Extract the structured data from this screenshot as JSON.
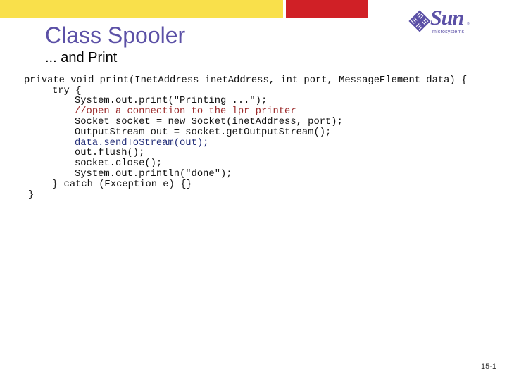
{
  "header": {
    "colors": {
      "yellow": "#f9e04b",
      "red": "#d02026",
      "title": "#5b50a6"
    }
  },
  "slide": {
    "title": "Class Spooler",
    "subtitle": "... and Print",
    "page_number": "15-1"
  },
  "logo": {
    "icon": "sun-diamond-logo-icon",
    "wordmark": "Sun",
    "tm": "®",
    "tagline": "microsystems"
  },
  "code": {
    "lines": [
      {
        "text": "private void print(InetAddress inetAddress, int port, MessageElement data) {",
        "style": "normal"
      },
      {
        "text": "try {",
        "style": "normal"
      },
      {
        "text": "System.out.print(\"Printing ...\");",
        "style": "normal"
      },
      {
        "text": "//open a connection to the lpr printer",
        "style": "comment"
      },
      {
        "text": "Socket socket = new Socket(inetAddress, port);",
        "style": "normal"
      },
      {
        "text": "OutputStream out = socket.getOutputStream();",
        "style": "normal"
      },
      {
        "text": "data.sendToStream(out);",
        "style": "highlight"
      },
      {
        "text": "out.flush();",
        "style": "normal"
      },
      {
        "text": "socket.close();",
        "style": "normal"
      },
      {
        "text": "System.out.println(\"done\");",
        "style": "normal"
      },
      {
        "text": "} catch (Exception e) {}",
        "style": "normal"
      },
      {
        "text": "}",
        "style": "normal"
      }
    ]
  }
}
